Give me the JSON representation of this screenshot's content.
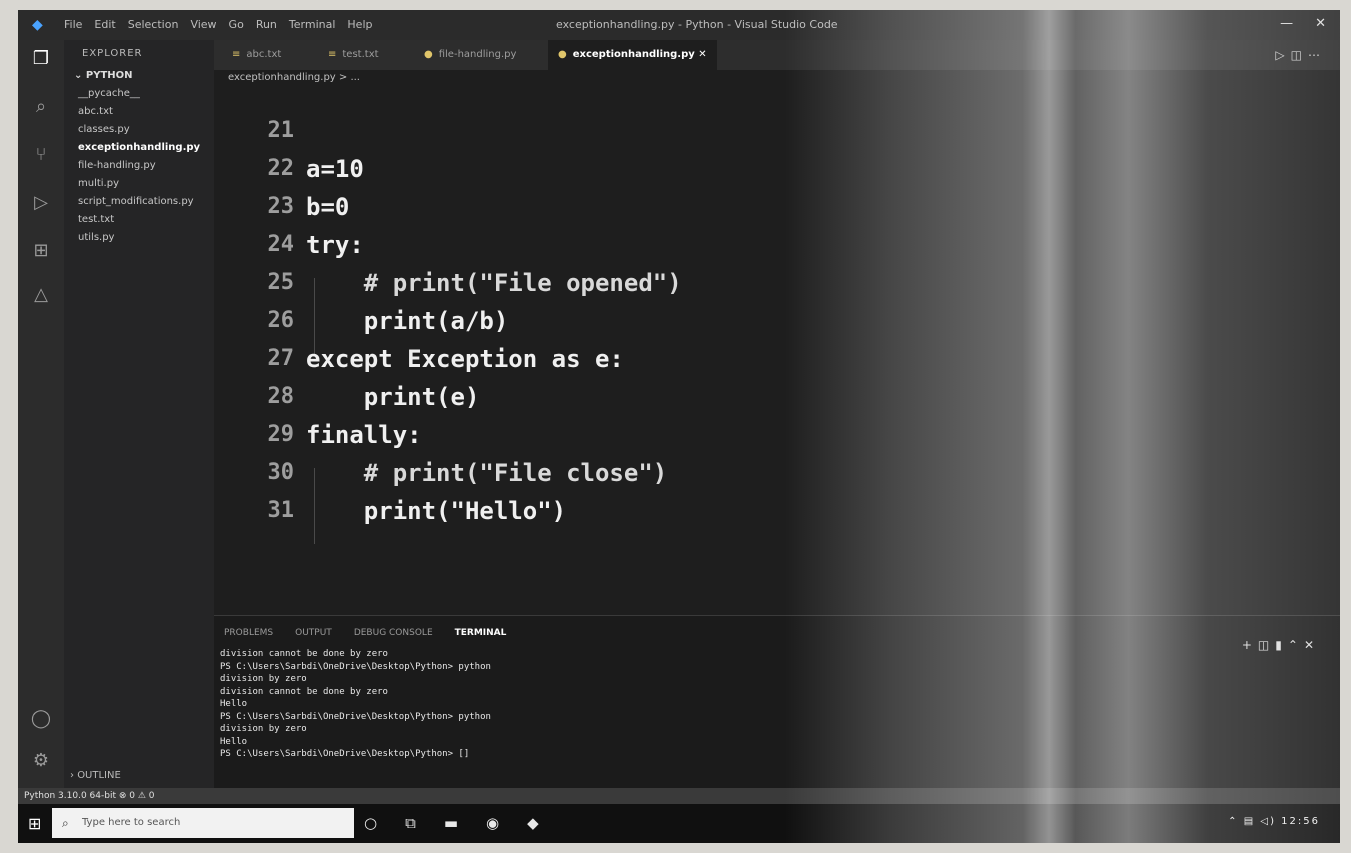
{
  "titlebar": {
    "menu": [
      "File",
      "Edit",
      "Selection",
      "View",
      "Go",
      "Run",
      "Terminal",
      "Help"
    ],
    "title": "exceptionhandling.py - Python - Visual Studio Code"
  },
  "sidebar": {
    "header": "EXPLORER",
    "folder": "PYTHON",
    "files": [
      "__pycache__",
      "abc.txt",
      "classes.py",
      "exceptionhandling.py",
      "file-handling.py",
      "multi.py",
      "script_modifications.py",
      "test.txt",
      "utils.py"
    ],
    "outline": "OUTLINE"
  },
  "tabs": [
    {
      "label": "abc.txt",
      "active": false
    },
    {
      "label": "test.txt",
      "active": false
    },
    {
      "label": "file-handling.py",
      "active": false
    },
    {
      "label": "exceptionhandling.py",
      "active": true
    }
  ],
  "breadcrumb": "exceptionhandling.py > ...",
  "editor": {
    "lines": [
      {
        "num": "21",
        "text": "",
        "comment": false
      },
      {
        "num": "22",
        "text": "a=10",
        "comment": false
      },
      {
        "num": "23",
        "text": "b=0",
        "comment": false
      },
      {
        "num": "24",
        "text": "try:",
        "comment": false
      },
      {
        "num": "25",
        "text": "    # print(\"File opened\")",
        "comment": true
      },
      {
        "num": "26",
        "text": "    print(a/b)",
        "comment": false
      },
      {
        "num": "27",
        "text": "except Exception as e:",
        "comment": false
      },
      {
        "num": "28",
        "text": "    print(e)",
        "comment": false
      },
      {
        "num": "29",
        "text": "finally:",
        "comment": false
      },
      {
        "num": "30",
        "text": "    # print(\"File close\")",
        "comment": true
      },
      {
        "num": "31",
        "text": "    print(\"Hello\")",
        "comment": false
      }
    ]
  },
  "panel": {
    "tabs": [
      "PROBLEMS",
      "OUTPUT",
      "DEBUG CONSOLE",
      "TERMINAL"
    ],
    "terminal": "division cannot be done by zero\nPS C:\\Users\\Sarbdi\\OneDrive\\Desktop\\Python> python\ndivision by zero\ndivision cannot be done by zero\nHello\nPS C:\\Users\\Sarbdi\\OneDrive\\Desktop\\Python> python\ndivision by zero\nHello\nPS C:\\Users\\Sarbdi\\OneDrive\\Desktop\\Python> []"
  },
  "statusbar": "Python 3.10.0 64-bit  ⊗ 0 ⚠ 0",
  "taskbar": {
    "search_placeholder": "Type here to search",
    "time": "12:56"
  }
}
